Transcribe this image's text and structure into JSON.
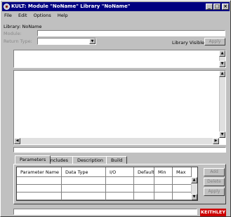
{
  "window": {
    "title": "KULT: Module \"NoName\" Library \"NoName\""
  },
  "menu": [
    "File",
    "Edit",
    "Options",
    "Help"
  ],
  "form": {
    "library_label": "Library: NoName",
    "module_label": "Module:",
    "module_value": "",
    "return_type_label": "Return Type:",
    "return_type_value": "",
    "library_visible_label": "Library Visible",
    "apply_label": "Apply"
  },
  "tabs": [
    "Parameters",
    "Includes",
    "Description",
    "Build"
  ],
  "parameters_table": {
    "columns": [
      "Parameter Name",
      "Data Type",
      "I/O",
      "Default",
      "Min",
      "Max"
    ],
    "rows": [
      [
        "",
        "",
        "",
        "",
        "",
        ""
      ],
      [
        "",
        "",
        "",
        "",
        "",
        ""
      ],
      [
        "",
        "",
        "",
        "",
        "",
        ""
      ]
    ]
  },
  "side_buttons": [
    "Add",
    "Delete",
    "Apply"
  ],
  "logo": "KEITHLEY"
}
